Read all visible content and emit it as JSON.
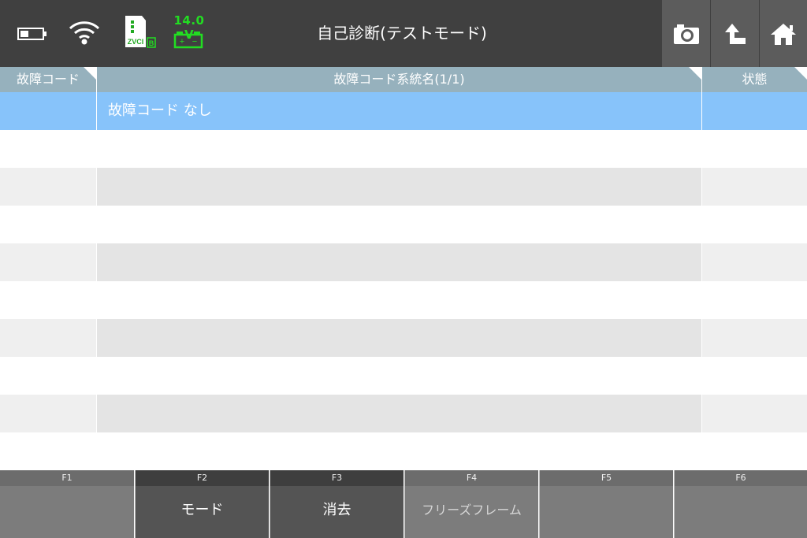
{
  "header": {
    "title": "自己診断(テストモード)",
    "voltage": "14.0 V",
    "vci_label": "ZVCI",
    "vci_badge": "B",
    "icons": {
      "battery": "battery-icon",
      "wifi": "wifi-icon",
      "vci": "vci-adapter-icon",
      "car_battery": "car-battery-icon",
      "camera": "camera-icon",
      "back": "back-arrow-icon",
      "home": "home-icon"
    }
  },
  "table": {
    "headers": [
      "故障コード",
      "故障コード系統名(1/1)",
      "状態"
    ],
    "rows": [
      {
        "code": "",
        "name": "故障コード なし",
        "status": ""
      },
      {
        "code": "",
        "name": "",
        "status": ""
      },
      {
        "code": "",
        "name": "",
        "status": ""
      },
      {
        "code": "",
        "name": "",
        "status": ""
      },
      {
        "code": "",
        "name": "",
        "status": ""
      },
      {
        "code": "",
        "name": "",
        "status": ""
      },
      {
        "code": "",
        "name": "",
        "status": ""
      },
      {
        "code": "",
        "name": "",
        "status": ""
      },
      {
        "code": "",
        "name": "",
        "status": ""
      },
      {
        "code": "",
        "name": "",
        "status": ""
      }
    ]
  },
  "function_keys": [
    {
      "key": "F1",
      "label": ""
    },
    {
      "key": "F2",
      "label": "モード"
    },
    {
      "key": "F3",
      "label": "消去"
    },
    {
      "key": "F4",
      "label": "フリーズフレーム"
    },
    {
      "key": "F5",
      "label": ""
    },
    {
      "key": "F6",
      "label": ""
    }
  ],
  "colors": {
    "topbar": "#404040",
    "header_row": "#96b1bd",
    "selected_row": "#87c3fa",
    "voltage_green": "#22dd22"
  }
}
